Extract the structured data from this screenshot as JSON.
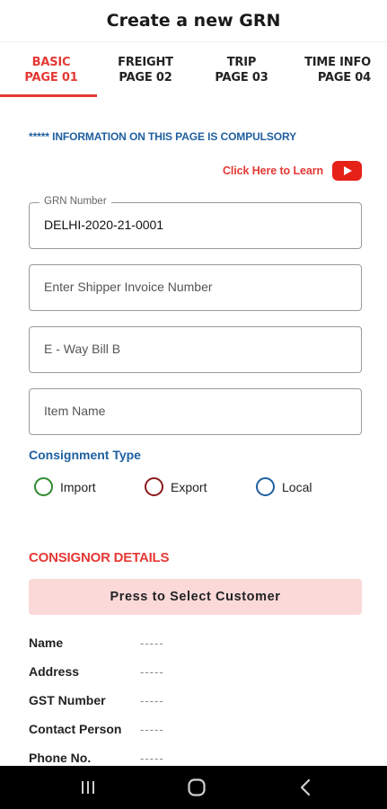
{
  "header": {
    "title": "Create a new GRN"
  },
  "tabs": [
    {
      "line1": "BASIC",
      "line2": "PAGE 01",
      "active": true
    },
    {
      "line1": "FREIGHT",
      "line2": "PAGE 02",
      "active": false
    },
    {
      "line1": "TRIP",
      "line2": "PAGE 03",
      "active": false
    },
    {
      "line1": "TIME INFO",
      "line2": "PAGE 04",
      "active": false
    }
  ],
  "notice": "***** INFORMATION ON THIS PAGE IS COMPULSORY",
  "learn_link": {
    "label": "Click Here to Learn",
    "icon": "youtube-icon"
  },
  "fields": {
    "grn_number": {
      "label": "GRN Number",
      "value": "DELHI-2020-21-0001"
    },
    "shipper_invoice": {
      "placeholder": "Enter Shipper Invoice Number"
    },
    "eway_bill": {
      "placeholder": "E - Way Bill B"
    },
    "item_name": {
      "placeholder": "Item Name"
    }
  },
  "consignment": {
    "title": "Consignment Type",
    "options": [
      "Import",
      "Export",
      "Local"
    ]
  },
  "consignor": {
    "title": "CONSIGNOR DETAILS",
    "select_button": "Press to Select Customer",
    "details": [
      {
        "key": "Name",
        "value": "-----"
      },
      {
        "key": "Address",
        "value": "-----"
      },
      {
        "key": "GST Number",
        "value": "-----"
      },
      {
        "key": "Contact Person",
        "value": "-----"
      },
      {
        "key": "Phone No.",
        "value": "-----"
      }
    ]
  },
  "navbar": {
    "buttons": [
      "recent-apps-icon",
      "home-icon",
      "back-icon"
    ]
  },
  "colors": {
    "accent_red": "#e53935",
    "blue": "#1f5fa0",
    "button_pink": "#fbd9d9"
  }
}
